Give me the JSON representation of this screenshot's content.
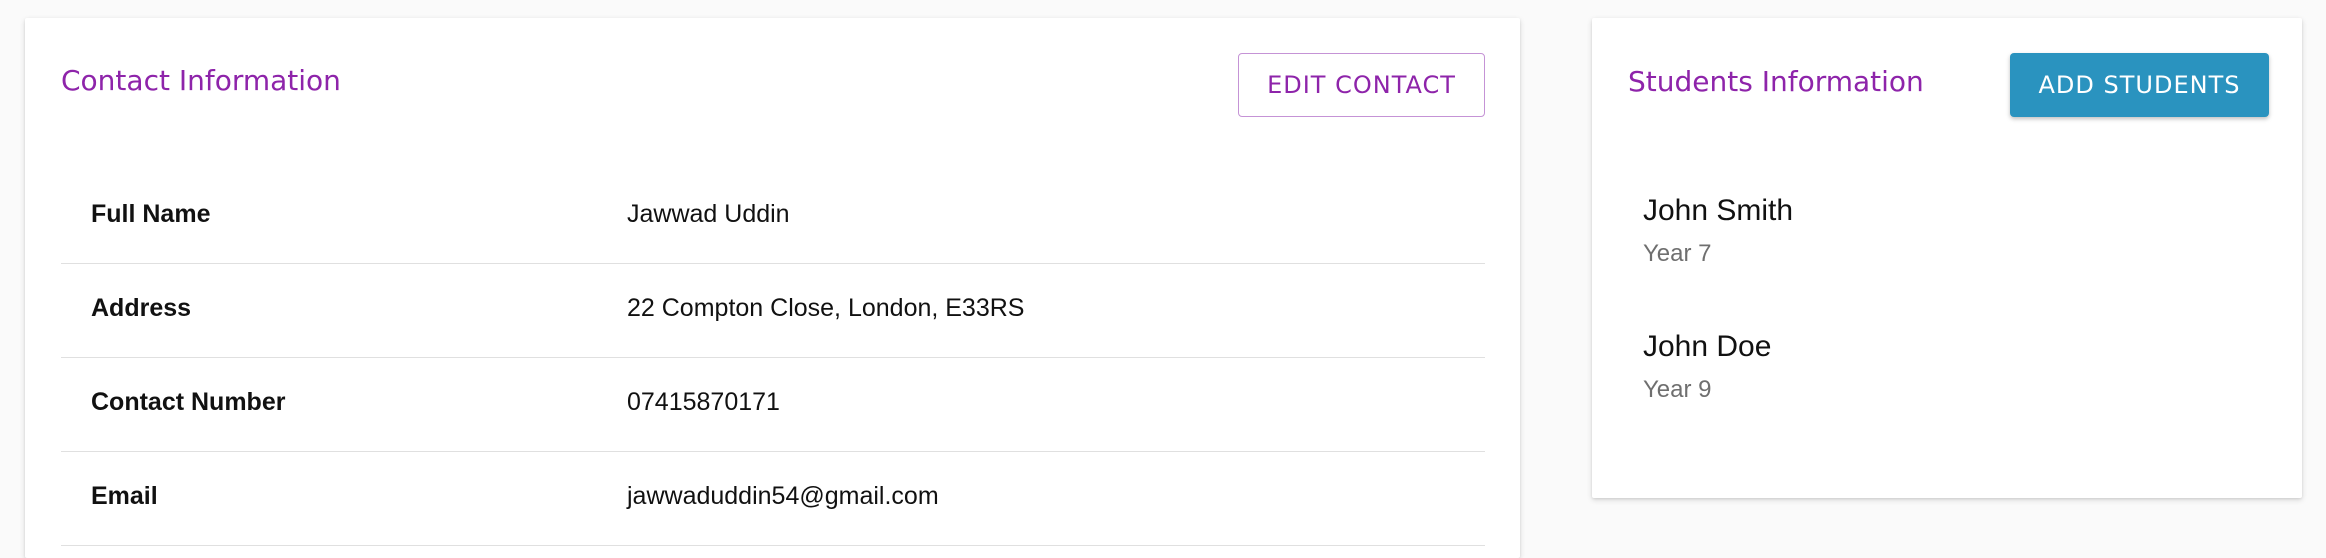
{
  "contact": {
    "title": "Contact Information",
    "edit_button_label": "EDIT CONTACT",
    "rows": [
      {
        "label": "Full Name",
        "value": "Jawwad Uddin"
      },
      {
        "label": "Address",
        "value": "22 Compton Close, London, E33RS"
      },
      {
        "label": "Contact Number",
        "value": "07415870171"
      },
      {
        "label": "Email",
        "value": "jawwaduddin54@gmail.com"
      }
    ]
  },
  "students": {
    "title": "Students Information",
    "add_button_label": "ADD STUDENTS",
    "items": [
      {
        "name": "John Smith",
        "year": "Year 7"
      },
      {
        "name": "John Doe",
        "year": "Year 9"
      }
    ]
  },
  "colors": {
    "title_accent": "#8e24aa",
    "primary_button": "#2a93bf"
  }
}
